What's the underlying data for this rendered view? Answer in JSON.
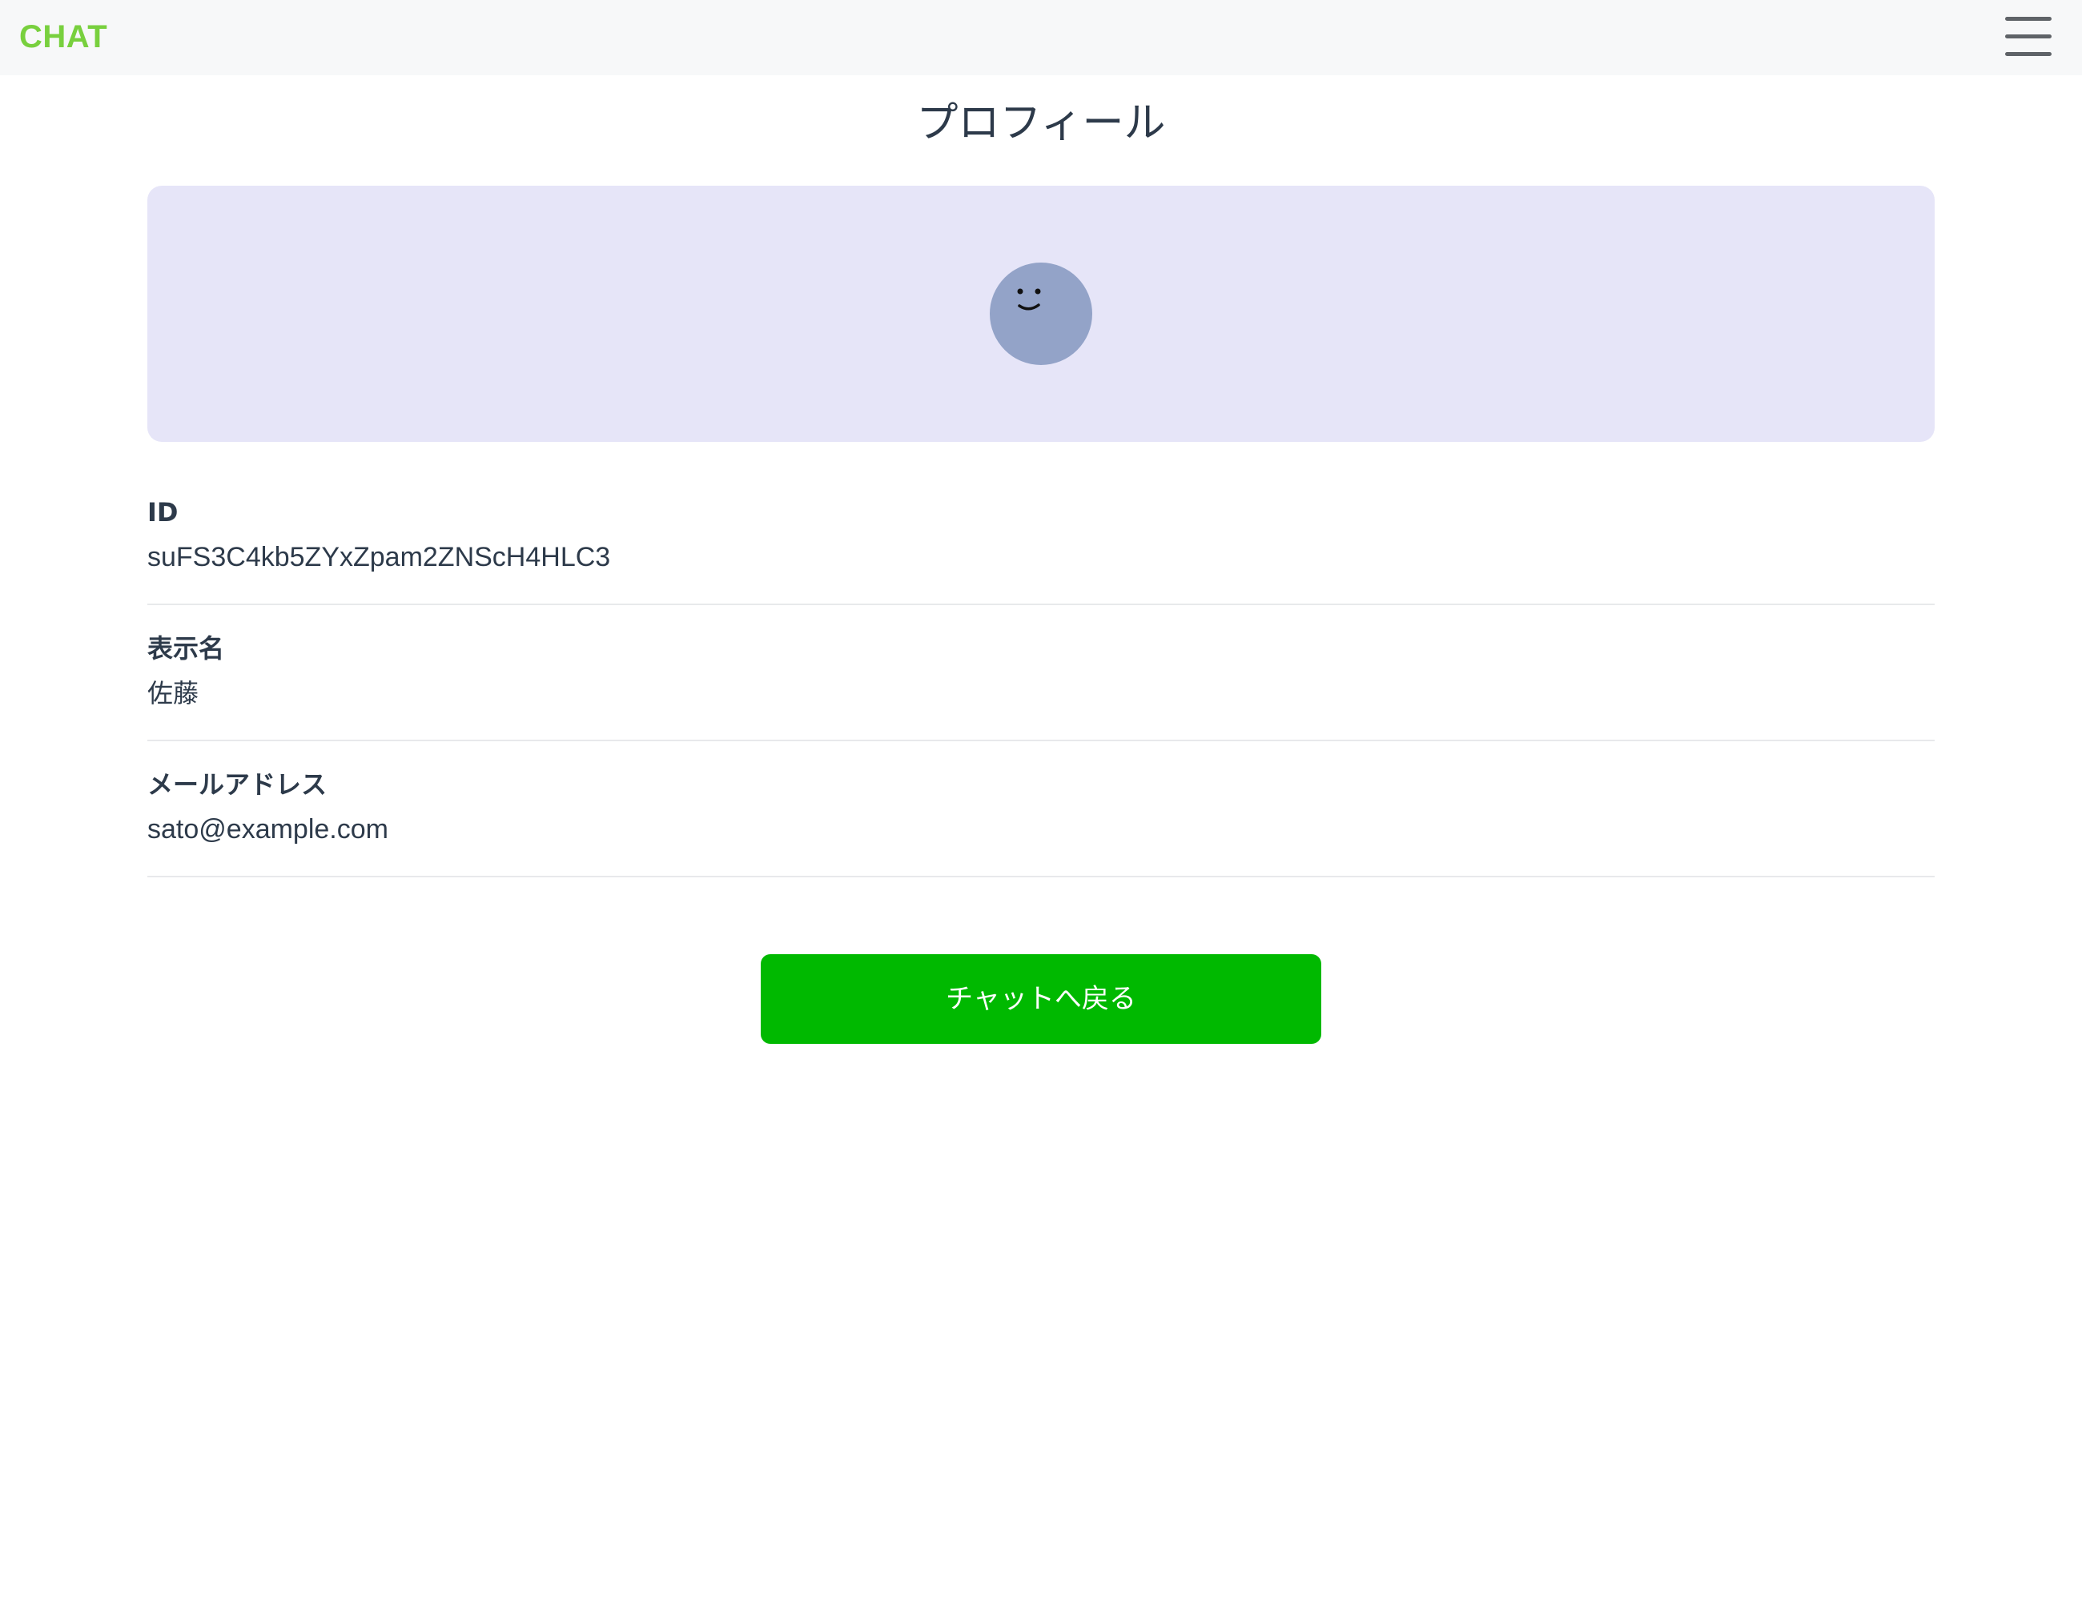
{
  "navbar": {
    "brand": "CHAT",
    "brand_color": "#78d03e",
    "menu_icon": "hamburger-menu-icon"
  },
  "page": {
    "title": "プロフィール"
  },
  "avatar": {
    "icon": "smiley-face-icon",
    "background_color": "#93a3c8",
    "panel_color": "#e6e5f8"
  },
  "profile": {
    "fields": [
      {
        "label": "ID",
        "value": "suFS3C4kb5ZYxZpam2ZNScH4HLC3"
      },
      {
        "label": "表示名",
        "value": "佐藤"
      },
      {
        "label": "メールアドレス",
        "value": "sato@example.com"
      }
    ]
  },
  "actions": {
    "back_to_chat_label": "チャットへ戻る",
    "button_color": "#00b900"
  }
}
